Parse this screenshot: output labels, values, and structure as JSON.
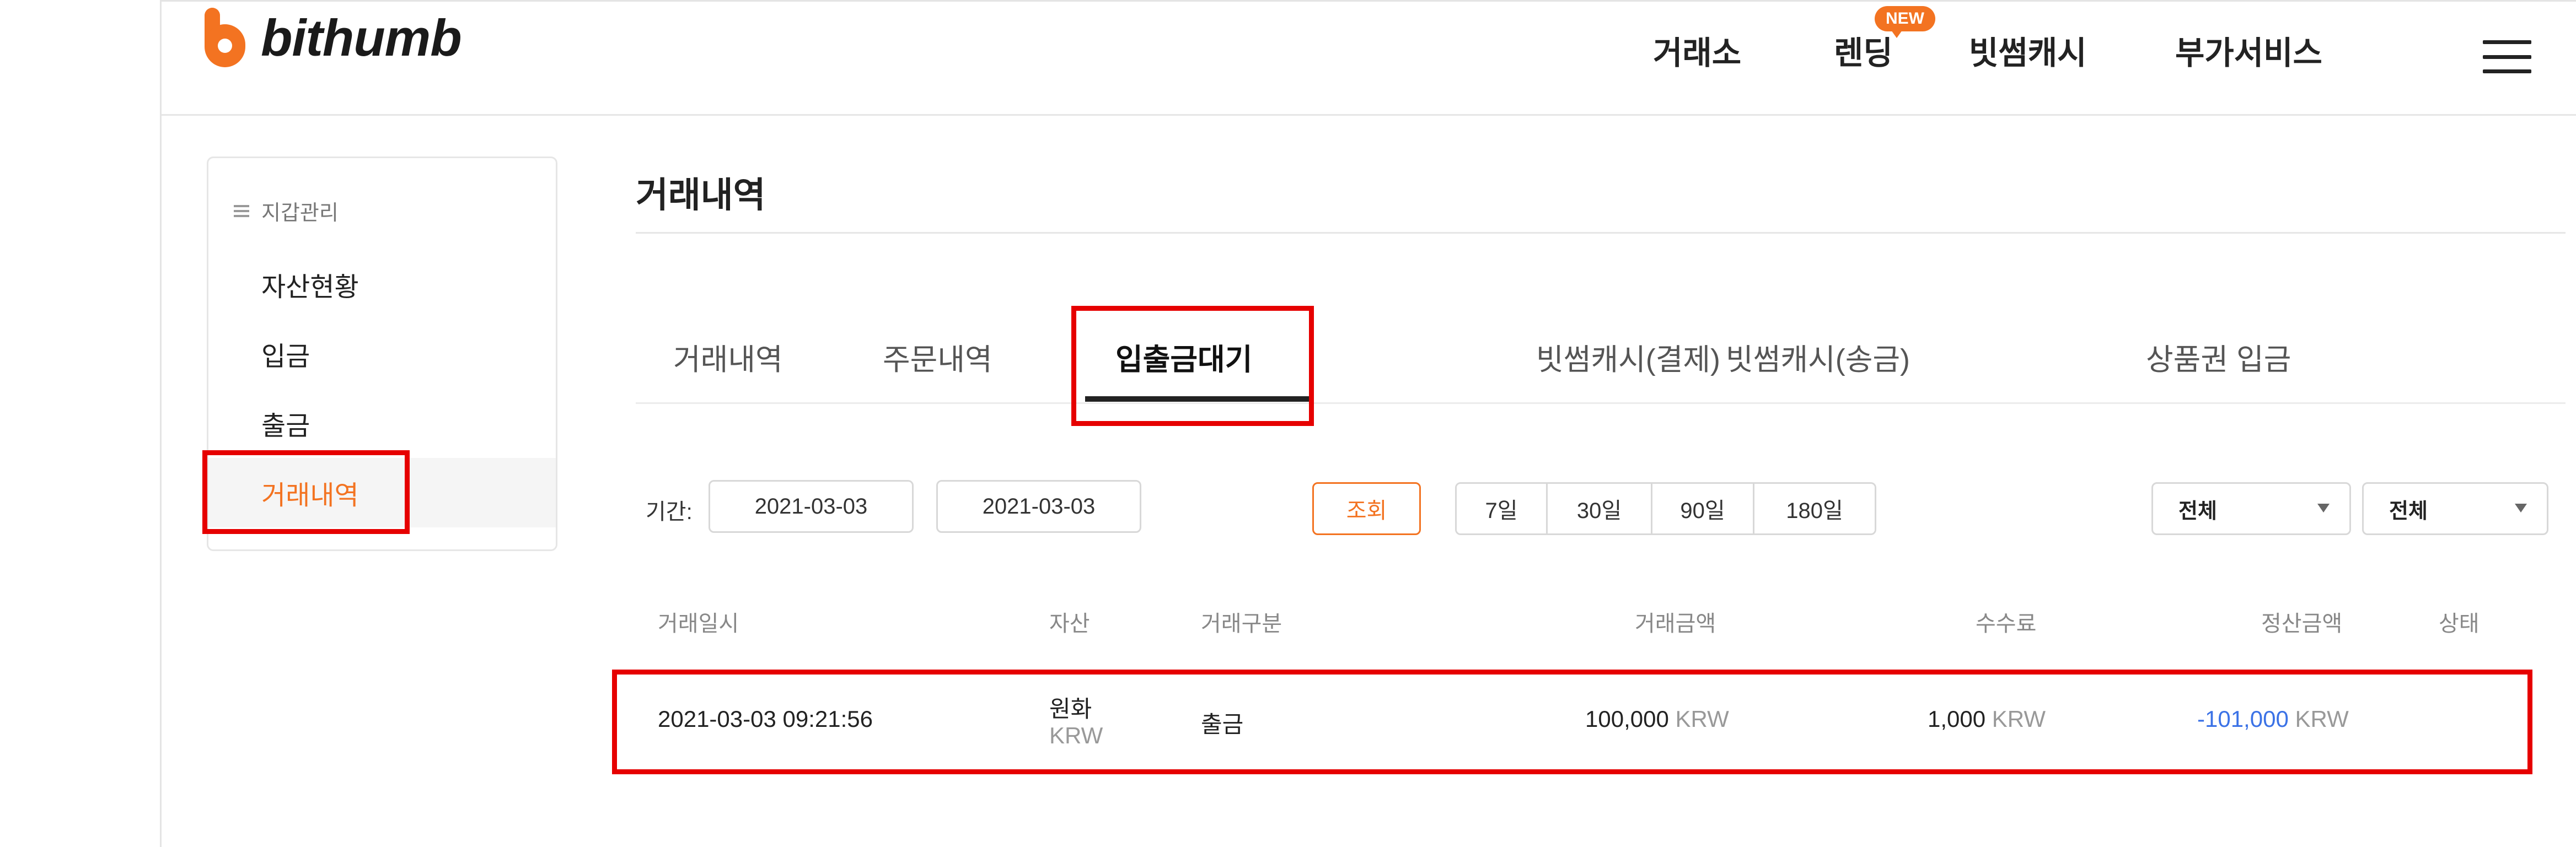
{
  "header": {
    "logo_text": "bithumb",
    "nav": [
      {
        "label": "거래소"
      },
      {
        "label": "렌딩"
      },
      {
        "label": "빗썸캐시"
      },
      {
        "label": "부가서비스"
      }
    ],
    "new_badge": "NEW",
    "menu_icon": "hamburger-icon"
  },
  "sidebar": {
    "heading": "지갑관리",
    "heading_icon": "list-icon",
    "items": [
      {
        "label": "자산현황"
      },
      {
        "label": "입금"
      },
      {
        "label": "출금"
      },
      {
        "label": "거래내역",
        "active": true
      }
    ]
  },
  "main": {
    "title": "거래내역",
    "tabs": [
      {
        "label": "거래내역"
      },
      {
        "label": "주문내역"
      },
      {
        "label": "입출금대기",
        "active": true
      },
      {
        "label": "빗썸캐시(결제)"
      },
      {
        "label": "빗썸캐시(송금)"
      },
      {
        "label": "상품권 입금"
      }
    ],
    "filter": {
      "period_label": "기간:",
      "start_date": "2021-03-03",
      "separator": "~",
      "end_date": "2021-03-03",
      "search_label": "조회",
      "ranges": [
        "7일",
        "30일",
        "90일",
        "180일"
      ],
      "select1": "전체",
      "select2": "전체"
    },
    "table": {
      "headers": [
        "거래일시",
        "자산",
        "거래구분",
        "거래금액",
        "수수료",
        "정산금액",
        "상태"
      ],
      "rows": [
        {
          "datetime": "2021-03-03 09:21:56",
          "asset_name": "원화",
          "asset_code": "KRW",
          "type": "출금",
          "amount": "100,000",
          "amount_unit": "KRW",
          "fee": "1,000",
          "fee_unit": "KRW",
          "settlement": "-101,000",
          "settlement_unit": "KRW",
          "status": ""
        }
      ]
    }
  },
  "colors": {
    "brand": "#f37321",
    "negative": "#3b72e6",
    "annotation": "#e60000"
  }
}
